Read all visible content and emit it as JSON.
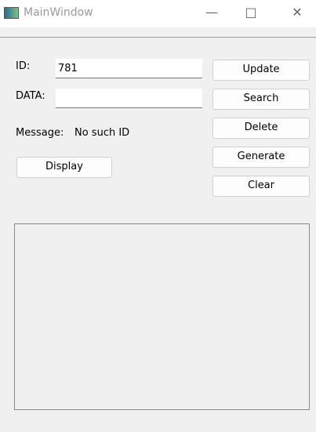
{
  "window": {
    "title": "MainWindow",
    "minimize_icon": "minimize-icon",
    "maximize_icon": "maximize-icon",
    "close_icon": "close-icon"
  },
  "form": {
    "id_label": "ID:",
    "id_value": "781",
    "data_label": "DATA:",
    "data_value": "",
    "message_label": "Message:",
    "message_value": "No such ID"
  },
  "buttons": {
    "update": "Update",
    "search": "Search",
    "delete": "Delete",
    "generate": "Generate",
    "clear": "Clear",
    "display": "Display"
  }
}
